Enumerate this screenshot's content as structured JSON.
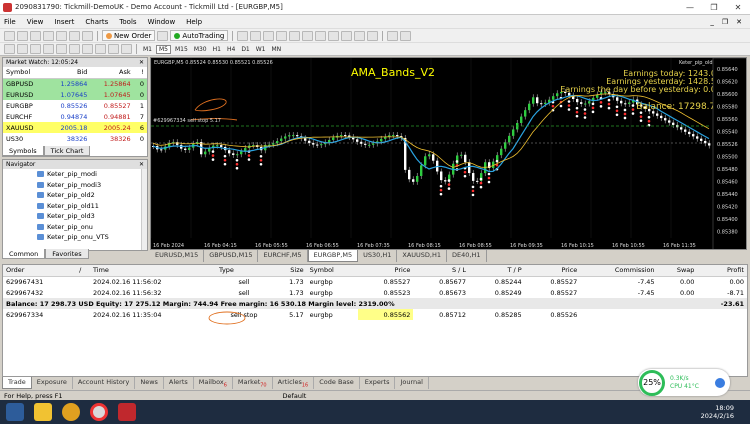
{
  "window": {
    "title": "2090831790: Tickmill-DemoUK - Demo Account - Tickmill Ltd - [EURGBP,M5]",
    "controls": [
      "—",
      "❐",
      "✕"
    ]
  },
  "menu": {
    "items": [
      "File",
      "View",
      "Insert",
      "Charts",
      "Tools",
      "Window",
      "Help"
    ],
    "mdi_controls": [
      "_",
      "❐",
      "✕"
    ]
  },
  "toolbar": {
    "new_order": "New Order",
    "autotrading": "AutoTrading",
    "timeframes": [
      "M1",
      "M5",
      "M15",
      "M30",
      "H1",
      "H4",
      "D1",
      "W1",
      "MN"
    ]
  },
  "market_watch": {
    "header": "Market Watch: 12:05:24",
    "columns": [
      "Symbol",
      "Bid",
      "Ask",
      "!"
    ],
    "rows": [
      {
        "symbol": "GBPUSD",
        "bid": "1.25864",
        "ask": "1.25864",
        "spread": "0",
        "bg": "#9fe39f"
      },
      {
        "symbol": "EURUSD",
        "bid": "1.07645",
        "ask": "1.07645",
        "spread": "0",
        "bg": "#9fe39f"
      },
      {
        "symbol": "EURGBP",
        "bid": "0.85526",
        "ask": "0.85527",
        "spread": "1",
        "bg": "#ffffff"
      },
      {
        "symbol": "EURCHF",
        "bid": "0.94874",
        "ask": "0.94881",
        "spread": "7",
        "bg": "#ffffff"
      },
      {
        "symbol": "XAUUSD",
        "bid": "2005.18",
        "ask": "2005.24",
        "spread": "6",
        "bg": "#ffff66"
      },
      {
        "symbol": "US30",
        "bid": "38326",
        "ask": "38326",
        "spread": "0",
        "bg": "#ffffff"
      }
    ],
    "tabs": [
      "Symbols",
      "Tick Chart"
    ]
  },
  "navigator": {
    "header": "Navigator",
    "items": [
      "Keter_pip_modi",
      "Keter_pip_modi3",
      "Keter_pip_old2",
      "Keter_pip_old11",
      "Keter_pip_old3",
      "Keter_pip_onu",
      "Keter_pip_onu_VTS"
    ],
    "tabs": [
      "Common",
      "Favorites"
    ]
  },
  "chart": {
    "info": "EURGBP,M5  0.85524 0.85530 0.85521 0.85526",
    "title": "AMA_Bands_V2",
    "ea_label": "Keter_pip_old11 ☺",
    "stats": [
      "Earnings today: 1243.02",
      "Earnings yesterday: 1428.56",
      "Earnings the day before yesterday: 0.00"
    ],
    "balance": "Balance: 17298.73",
    "order_label": "#629967334 sell stop 5.17",
    "price_scale": [
      "0.85640",
      "0.85620",
      "0.85600",
      "0.85580",
      "0.85560",
      "0.85540",
      "0.85526",
      "0.85500",
      "0.85480",
      "0.85460",
      "0.85440",
      "0.85420",
      "0.85400",
      "0.85380"
    ],
    "time_scale": [
      "16 Feb 2024",
      "16 Feb 04:15",
      "16 Feb 05:55",
      "16 Feb 06:55",
      "16 Feb 07:35",
      "16 Feb 08:15",
      "16 Feb 08:55",
      "16 Feb 09:35",
      "16 Feb 10:15",
      "16 Feb 10:55",
      "16 Feb 11:35"
    ]
  },
  "chart_tabs": [
    "EURUSD,M15",
    "GBPUSD,M15",
    "EURCHF,M5",
    "EURGBP,M5",
    "US30,H1",
    "XAUUSD,H1",
    "DE40,H1"
  ],
  "chart_tabs_active": 3,
  "terminal": {
    "columns": [
      "Order",
      "/",
      "Time",
      "Type",
      "Size",
      "Symbol",
      "Price",
      "S / L",
      "T / P",
      "Price",
      "Commission",
      "Swap",
      "Profit"
    ],
    "orders": [
      {
        "order": "629967431",
        "time": "2024.02.16 11:56:02",
        "type": "sell",
        "size": "1.73",
        "symbol": "eurgbp",
        "price": "0.85527",
        "sl": "0.85677",
        "tp": "0.85244",
        "cur": "0.85527",
        "commission": "-7.45",
        "swap": "0.00",
        "profit": "0.00"
      },
      {
        "order": "629967432",
        "time": "2024.02.16 11:56:32",
        "type": "sell",
        "size": "1.73",
        "symbol": "eurgbp",
        "price": "0.85523",
        "sl": "0.85673",
        "tp": "0.85249",
        "cur": "0.85527",
        "commission": "-7.45",
        "swap": "0.00",
        "profit": "-8.71"
      }
    ],
    "balance_line": {
      "text": "Balance: 17 298.73 USD   Equity: 17 275.12   Margin: 744.94   Free margin: 16 530.18   Margin level: 2319.00%",
      "profit": "-23.61"
    },
    "pending": {
      "order": "629967334",
      "time": "2024.02.16 11:35:04",
      "type": "sell stop",
      "size": "5.17",
      "symbol": "eurgbp",
      "price": "0.85562",
      "sl": "0.85712",
      "tp": "0.85285",
      "cur": "0.85526"
    },
    "tabs": [
      "Trade",
      "Exposure",
      "Account History",
      "News",
      "Alerts",
      "Mailbox",
      "Market",
      "Articles",
      "Code Base",
      "Experts",
      "Journal"
    ],
    "tab_badges": {
      "Mailbox": "6",
      "Market": "70",
      "Articles": "16"
    }
  },
  "status": {
    "help": "For Help, press F1",
    "profile": "Default"
  },
  "widget": {
    "percent": "25%",
    "net": "0.3K/s",
    "cpu": "CPU 41°C"
  },
  "clock": {
    "time": "18:09",
    "date": "2024/2/16"
  }
}
